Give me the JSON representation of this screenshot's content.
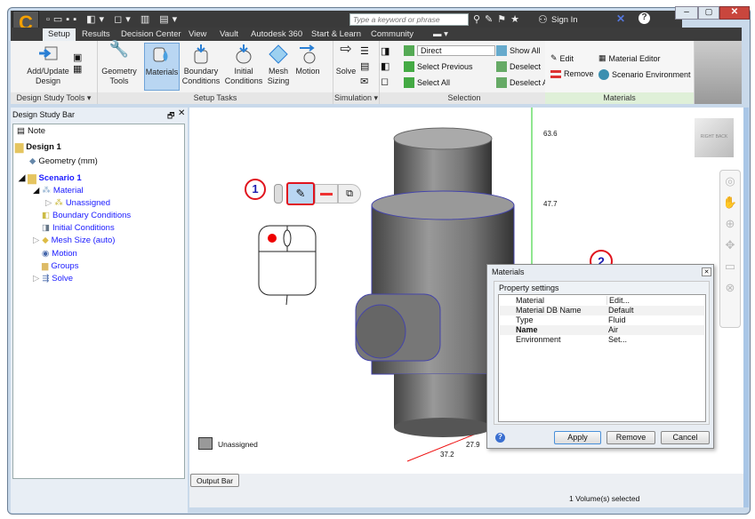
{
  "quick_access": {
    "search_placeholder": "Type a keyword or phrase",
    "sign_in": "Sign In"
  },
  "tabs": [
    "Setup",
    "Results",
    "Decision Center",
    "View",
    "Vault",
    "Autodesk 360",
    "Start & Learn",
    "Community"
  ],
  "ribbon": {
    "design_study_tools": {
      "label": "Design Study Tools ▾",
      "add_update": "Add/Update",
      "design": "Design"
    },
    "setup_tasks": {
      "label": "Setup Tasks",
      "geometry": "Geometry",
      "tools": "Tools",
      "materials": "Materials",
      "boundary": "Boundary",
      "conditions": "Conditions",
      "initial": "Initial",
      "mesh": "Mesh",
      "sizing": "Sizing",
      "motion": "Motion"
    },
    "simulation": {
      "label": "Simulation ▾",
      "solve": "Solve"
    },
    "selection": {
      "label": "Selection",
      "mode": "Direct",
      "select_previous": "Select Previous",
      "select_all": "Select All",
      "show_all": "Show All",
      "deselect": "Deselect",
      "deselect_all": "Deselect All"
    },
    "materials": {
      "label": "Materials",
      "edit": "Edit",
      "remove": "Remove",
      "material_editor": "Material Editor",
      "scenario_environment": "Scenario Environment"
    }
  },
  "design_study_bar": {
    "title": "Design Study Bar",
    "items": [
      "Note",
      "Design 1",
      "Geometry (mm)",
      "Scenario 1",
      "Material",
      "Unassigned",
      "Boundary Conditions",
      "Initial Conditions",
      "Mesh Size (auto)",
      "Motion",
      "Groups",
      "Solve"
    ]
  },
  "viewport": {
    "axis_labels": [
      "63.6",
      "47.7",
      "27.9",
      "37.2"
    ],
    "legend": "Unassigned",
    "callouts": [
      "1",
      "2"
    ],
    "viewcube": [
      "RIGHT",
      "BACK"
    ]
  },
  "dialog": {
    "title": "Materials",
    "section": "Property settings",
    "rows": [
      [
        "Material",
        "Edit..."
      ],
      [
        "Material DB Name",
        "Default"
      ],
      [
        "Type",
        "Fluid"
      ],
      [
        "Name",
        "Air"
      ],
      [
        "Environment",
        "Set..."
      ]
    ],
    "apply": "Apply",
    "remove": "Remove",
    "cancel": "Cancel"
  },
  "output_bar": "Output Bar",
  "status": "1 Volume(s) selected",
  "colors": {
    "accent_selected": "#b9d6f2",
    "callout": "#e0141e",
    "materials_group": "#dff0d8"
  }
}
